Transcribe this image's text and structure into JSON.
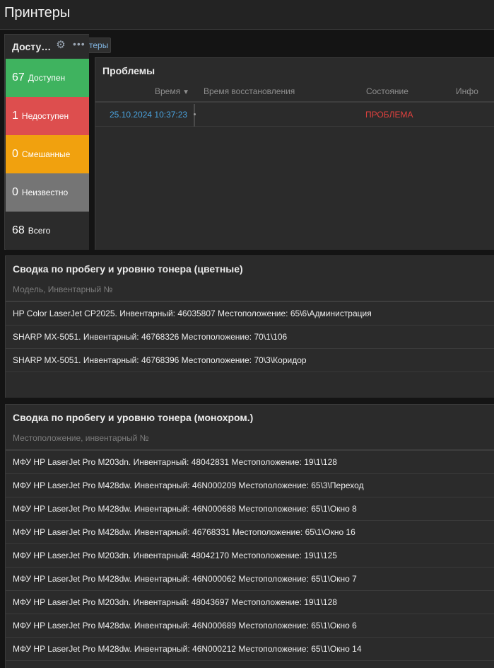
{
  "page": {
    "title": "Принтеры"
  },
  "breadcrumb": {
    "label": "теры"
  },
  "availability": {
    "title": "Доступ...",
    "gear_icon": "gear-icon",
    "more_icon": "more-icon",
    "stats": [
      {
        "count": "67",
        "label": "Доступен",
        "color": "#3fb35f"
      },
      {
        "count": "1",
        "label": "Недоступен",
        "color": "#dd4e4e"
      },
      {
        "count": "0",
        "label": "Смешанные",
        "color": "#f1a10e"
      },
      {
        "count": "0",
        "label": "Неизвестно",
        "color": "#757575"
      },
      {
        "count": "68",
        "label": "Всего",
        "color": "#2b2b2b"
      }
    ]
  },
  "problems": {
    "title": "Проблемы",
    "columns": {
      "time": "Время",
      "recovery": "Время восстановления",
      "status": "Состояние",
      "info": "Инфо"
    },
    "rows": [
      {
        "time": "25.10.2024 10:37:23",
        "recovery": "",
        "status": "ПРОБЛЕМА",
        "info": ""
      }
    ],
    "colors": {
      "time_link": "#4aa3df",
      "problem": "#e0413e"
    }
  },
  "toner_color": {
    "title": "Сводка по пробегу и уровню тонера (цветные)",
    "column": "Модель, Инвентарный №",
    "rows": [
      "HP Color LaserJet CP2025. Инвентарный: 46035807 Местоположение: 65\\6\\Администрация",
      "SHARP MX-5051. Инвентарный: 46768326 Местоположение: 70\\1\\106",
      "SHARP MX-5051. Инвентарный: 46768396 Местоположение: 70\\3\\Коридор"
    ]
  },
  "toner_mono": {
    "title": "Сводка по пробегу и уровню тонера (монохром.)",
    "column": "Местоположение, инвентарный №",
    "rows": [
      "МФУ HP LaserJet Pro M203dn. Инвентарный: 48042831 Местоположение: 19\\1\\128",
      "МФУ HP LaserJet Pro M428dw. Инвентарный: 46N000209 Местоположение: 65\\3\\Переход",
      "МФУ HP LaserJet Pro M428dw. Инвентарный: 46N000688 Местоположение: 65\\1\\Окно 8",
      "МФУ HP LaserJet Pro M428dw. Инвентарный: 46768331 Местоположение: 65\\1\\Окно 16",
      "МФУ HP LaserJet Pro M203dn. Инвентарный: 48042170 Местоположение: 19\\1\\125",
      "МФУ HP LaserJet Pro M428dw. Инвентарный: 46N000062 Местоположение: 65\\1\\Окно 7",
      "МФУ HP LaserJet Pro M203dn. Инвентарный: 48043697 Местоположение: 19\\1\\128",
      "МФУ HP LaserJet Pro M428dw. Инвентарный: 46N000689 Местоположение: 65\\1\\Окно 6",
      "МФУ HP LaserJet Pro M428dw. Инвентарный: 46N000212 Местоположение: 65\\1\\Окно 14"
    ]
  }
}
